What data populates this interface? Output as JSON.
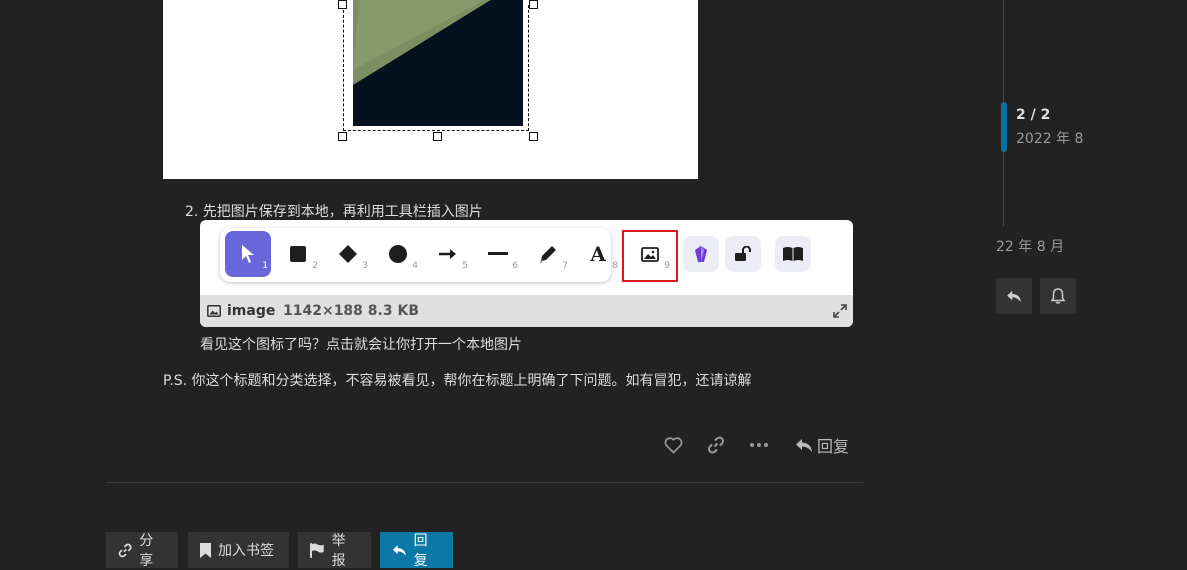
{
  "post": {
    "step2": "2. 先把图片保存到本地，再利用工具栏插入图片",
    "hint": "看见这个图标了吗？点击就会让你打开一个本地图片",
    "ps": "P.S. 你这个标题和分类选择，不容易被看见，帮你在标题上明确了下问题。如有冒犯，还请谅解",
    "reply_label": "回复"
  },
  "toolbar_image": {
    "tools": [
      {
        "icon": "pointer-icon",
        "num": "1"
      },
      {
        "icon": "rectangle-icon",
        "num": "2"
      },
      {
        "icon": "diamond-icon",
        "num": "3"
      },
      {
        "icon": "ellipse-icon",
        "num": "4"
      },
      {
        "icon": "arrow-icon",
        "num": "5"
      },
      {
        "icon": "line-icon",
        "num": "6"
      },
      {
        "icon": "pencil-icon",
        "num": "7"
      },
      {
        "icon": "text-icon",
        "num": "8"
      },
      {
        "icon": "image-icon",
        "num": "9"
      }
    ],
    "text_glyph": "A",
    "caption_name": "image",
    "caption_meta": "1142×188 8.3 KB"
  },
  "bottom_buttons": {
    "share": "分享",
    "bookmark": "加入书签",
    "flag": "举报",
    "reply": "回复"
  },
  "timeline": {
    "count": "2 / 2",
    "date": "2022 年 8",
    "end_date": "22 年 8 月"
  },
  "colors": {
    "background": "#222222",
    "primary_button": "#0b78a6",
    "active_tool": "#6965db",
    "highlight": "#e0161b",
    "timeline": "#0a70a0"
  }
}
